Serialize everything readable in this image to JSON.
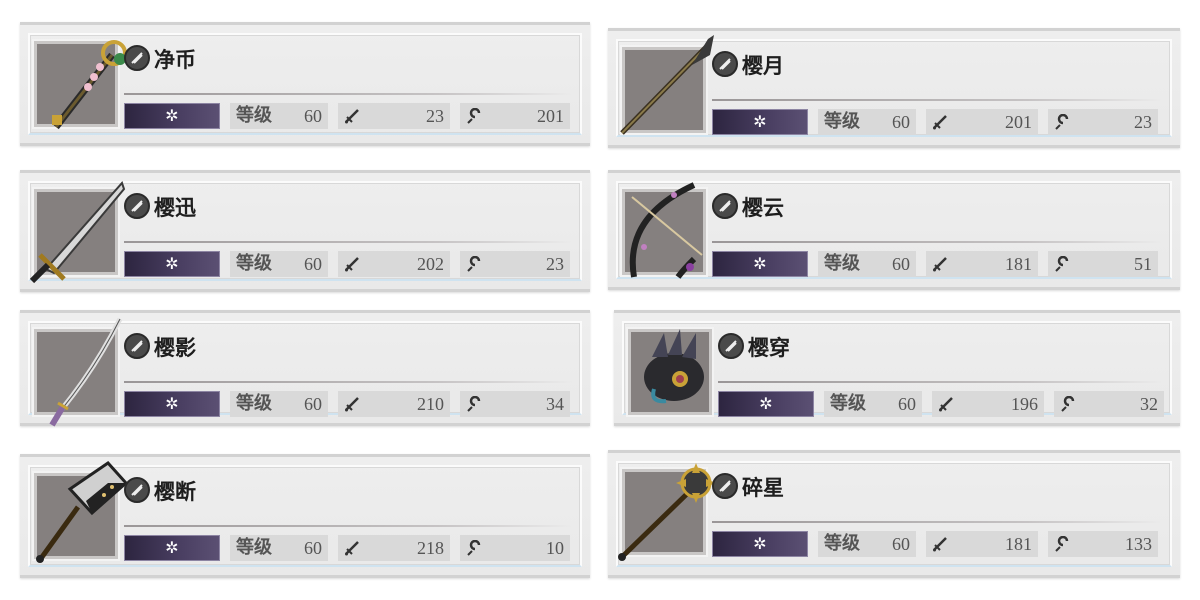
{
  "colors": {
    "thumb_bg": "#85807f",
    "element_bar": "#3b3152",
    "stat_cell": "#d9d9d9",
    "card_bg": "#eeeeee"
  },
  "labels": {
    "level": "等级",
    "element_glyph": "✲"
  },
  "weapons": [
    {
      "name": "净币",
      "type_icon": "gunbai-icon",
      "weapon_icon": "staff-icon",
      "level": "60",
      "attack": "23",
      "crit": "201"
    },
    {
      "name": "樱月",
      "type_icon": "spear-icon",
      "weapon_icon": "spear-icon",
      "level": "60",
      "attack": "201",
      "crit": "23"
    },
    {
      "name": "樱迅",
      "type_icon": "sword-icon",
      "weapon_icon": "sword-icon",
      "level": "60",
      "attack": "202",
      "crit": "23"
    },
    {
      "name": "樱云",
      "type_icon": "bow-icon",
      "weapon_icon": "bow-icon",
      "level": "60",
      "attack": "181",
      "crit": "51"
    },
    {
      "name": "樱影",
      "type_icon": "katana-icon",
      "weapon_icon": "katana-icon",
      "level": "60",
      "attack": "210",
      "crit": "34"
    },
    {
      "name": "樱穿",
      "type_icon": "gauntlet-icon",
      "weapon_icon": "gauntlet-icon",
      "level": "60",
      "attack": "196",
      "crit": "32"
    },
    {
      "name": "樱断",
      "type_icon": "cleaver-icon",
      "weapon_icon": "cleaver-icon",
      "level": "60",
      "attack": "218",
      "crit": "10"
    },
    {
      "name": "碎星",
      "type_icon": "mace-icon",
      "weapon_icon": "mace-icon",
      "level": "60",
      "attack": "181",
      "crit": "133"
    }
  ]
}
